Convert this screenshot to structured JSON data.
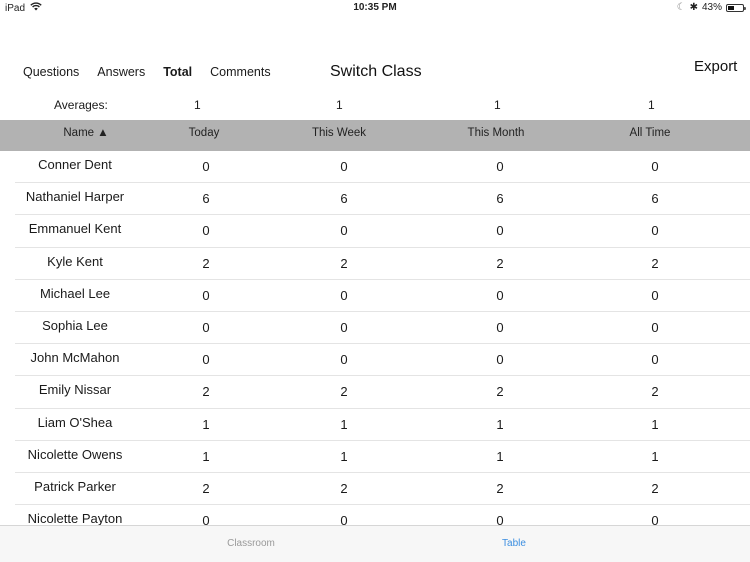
{
  "status_bar": {
    "device": "iPad",
    "time": "10:35 PM",
    "battery": "43%",
    "battery_level": 0.43
  },
  "segments": [
    {
      "label": "Questions",
      "active": false
    },
    {
      "label": "Answers",
      "active": false
    },
    {
      "label": "Total",
      "active": true
    },
    {
      "label": "Comments",
      "active": false
    }
  ],
  "switch_class_label": "Switch Class",
  "export_label": "Export",
  "averages": {
    "label": "Averages:",
    "today": "1",
    "this_week": "1",
    "this_month": "1",
    "all_time": "1"
  },
  "columns": {
    "name": "Name ▲",
    "today": "Today",
    "this_week": "This Week",
    "this_month": "This Month",
    "all_time": "All Time"
  },
  "rows": [
    {
      "name": "Conner Dent",
      "today": "0",
      "this_week": "0",
      "this_month": "0",
      "all_time": "0"
    },
    {
      "name": "Nathaniel Harper",
      "today": "6",
      "this_week": "6",
      "this_month": "6",
      "all_time": "6"
    },
    {
      "name": "Emmanuel Kent",
      "today": "0",
      "this_week": "0",
      "this_month": "0",
      "all_time": "0"
    },
    {
      "name": "Kyle Kent",
      "today": "2",
      "this_week": "2",
      "this_month": "2",
      "all_time": "2"
    },
    {
      "name": "Michael Lee",
      "today": "0",
      "this_week": "0",
      "this_month": "0",
      "all_time": "0"
    },
    {
      "name": "Sophia Lee",
      "today": "0",
      "this_week": "0",
      "this_month": "0",
      "all_time": "0"
    },
    {
      "name": "John McMahon",
      "today": "0",
      "this_week": "0",
      "this_month": "0",
      "all_time": "0"
    },
    {
      "name": "Emily Nissar",
      "today": "2",
      "this_week": "2",
      "this_month": "2",
      "all_time": "2"
    },
    {
      "name": "Liam O'Shea",
      "today": "1",
      "this_week": "1",
      "this_month": "1",
      "all_time": "1"
    },
    {
      "name": "Nicolette Owens",
      "today": "1",
      "this_week": "1",
      "this_month": "1",
      "all_time": "1"
    },
    {
      "name": "Patrick Parker",
      "today": "2",
      "this_week": "2",
      "this_month": "2",
      "all_time": "2"
    },
    {
      "name": "Nicolette Payton",
      "today": "0",
      "this_week": "0",
      "this_month": "0",
      "all_time": "0"
    }
  ],
  "tab_bar": {
    "classroom": "Classroom",
    "table": "Table",
    "active_color": "#3b8ee0",
    "inactive_color": "#9a9a9a"
  }
}
